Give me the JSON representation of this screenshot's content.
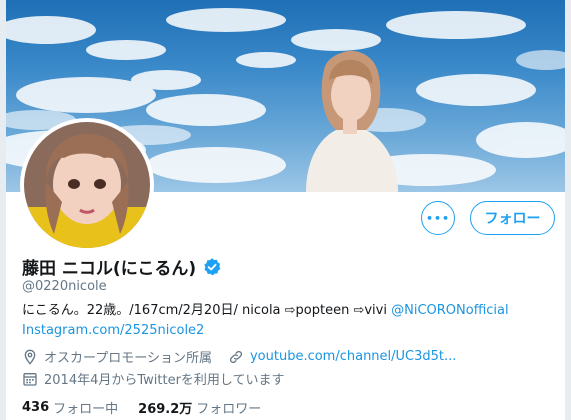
{
  "profile": {
    "display_name": "藤田 ニコル(にこるん)",
    "handle": "@0220nicole",
    "bio_text": "にこるん。22歳。/167cm/2月20日/ nicola ⇨popteen ⇨vivi ",
    "bio_mention": "@NiCORONofficial",
    "bio_link": "Instagram.com/2525nicole2"
  },
  "meta": {
    "location": "オスカープロモーション所属",
    "website": "youtube.com/channel/UC3d5t...",
    "joined": "2014年4月からTwitterを利用しています"
  },
  "stats": {
    "following_count": "436",
    "following_label": "フォロー中",
    "followers_count": "269.2万",
    "followers_label": "フォロワー"
  },
  "buttons": {
    "more_label": "•••",
    "follow_label": "フォロー"
  },
  "colors": {
    "accent": "#1da1f2",
    "secondary_text": "#657786",
    "link": "#1b95e0"
  },
  "icons": [
    "verified-badge-icon",
    "location-icon",
    "link-icon",
    "calendar-icon",
    "more-icon"
  ]
}
